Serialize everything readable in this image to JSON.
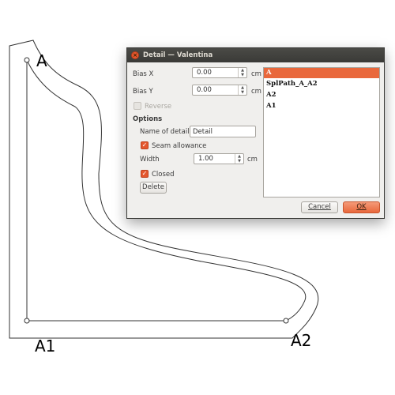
{
  "canvas": {
    "point_labels": [
      "A",
      "A1",
      "A2"
    ]
  },
  "dialog": {
    "title": "Detail — Valentina",
    "bias_x_label": "Bias X",
    "bias_x_value": "0.00",
    "bias_x_unit": "cm",
    "bias_y_label": "Bias Y",
    "bias_y_value": "0.00",
    "bias_y_unit": "cm",
    "reverse_label": "Reverse",
    "options_heading": "Options",
    "name_label": "Name of detail",
    "name_value": "Detail",
    "seam_allowance_label": "Seam allowance",
    "width_label": "Width",
    "width_value": "1.00",
    "width_unit": "cm",
    "closed_label": "Closed",
    "delete_label": "Delete",
    "cancel_label": "Cancel",
    "ok_label": "OK",
    "list_items": [
      "A",
      "SplPath_A_A2",
      "A2",
      "A1"
    ]
  },
  "colors": {
    "accent": "#e9683c",
    "titlebar": "#3a3a37"
  }
}
